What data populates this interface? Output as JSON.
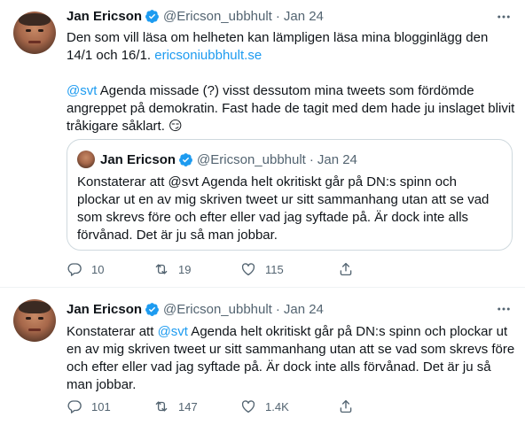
{
  "tweets": [
    {
      "author_name": "Jan Ericson",
      "handle": "@Ericson_ubbhult",
      "time": "Jan 24",
      "body": {
        "line1_text": "Den som vill läsa om helheten kan lämpligen läsa mina blogginlägg den 14/1 och 16/1. ",
        "line1_link": "ericsoniubbhult.se",
        "mention": "@svt",
        "line2_text": " Agenda missade (?) visst dessutom mina tweets som fördömde angreppet på demokratin. Fast hade de tagit med dem hade ju inslaget blivit tråkigare såklart. ",
        "emoji": "😏"
      },
      "quote": {
        "author_name": "Jan Ericson",
        "handle": "@Ericson_ubbhult",
        "time": "Jan 24",
        "text": "Konstaterar att @svt Agenda helt okritiskt går på DN:s spinn och plockar ut en av mig skriven tweet ur sitt sammanhang utan att se vad som skrevs före och efter eller vad jag syftade på. Är dock inte alls förvånad. Det är ju så man jobbar."
      },
      "actions": {
        "replies": "10",
        "retweets": "19",
        "likes": "115"
      }
    },
    {
      "author_name": "Jan Ericson",
      "handle": "@Ericson_ubbhult",
      "time": "Jan 24",
      "body": {
        "prefix": "Konstaterar att ",
        "mention": "@svt",
        "rest": " Agenda helt okritiskt går på DN:s spinn och plockar ut en av mig skriven tweet ur sitt sammanhang utan att se vad som skrevs före och efter eller vad jag syftade på. Är dock inte alls förvånad. Det är ju så man jobbar."
      },
      "actions": {
        "replies": "101",
        "retweets": "147",
        "likes": "1.4K"
      }
    }
  ],
  "icons": {
    "verified": "verified-badge-icon",
    "more": "more-horizontal-icon",
    "reply": "reply-icon",
    "retweet": "retweet-icon",
    "like": "heart-icon",
    "share": "share-icon"
  },
  "colors": {
    "link": "#1d9bf0",
    "text": "#0f1419",
    "muted": "#536471",
    "border": "#cfd9de"
  }
}
